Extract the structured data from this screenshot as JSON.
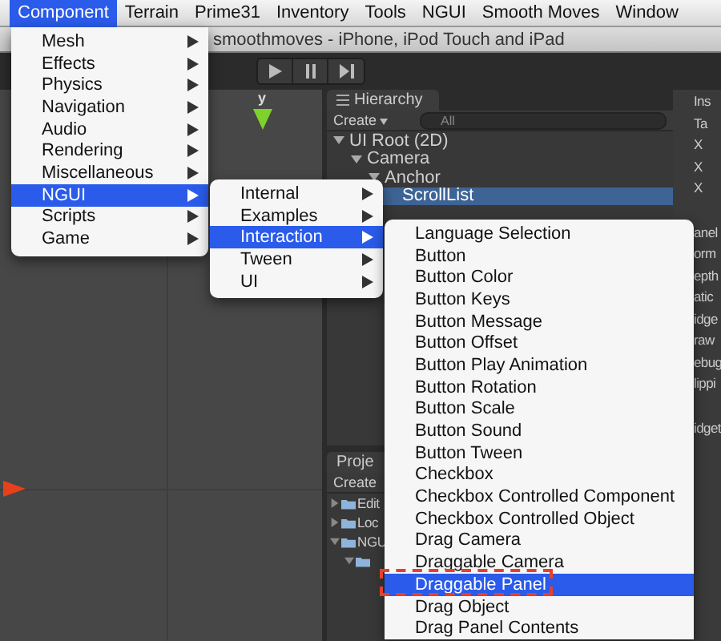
{
  "menu_bar": {
    "items": [
      {
        "label": "Component",
        "selected": true
      },
      {
        "label": "Terrain",
        "selected": false
      },
      {
        "label": "Prime31",
        "selected": false
      },
      {
        "label": "Inventory",
        "selected": false
      },
      {
        "label": "Tools",
        "selected": false
      },
      {
        "label": "NGUI",
        "selected": false
      },
      {
        "label": "Smooth Moves",
        "selected": false
      },
      {
        "label": "Window",
        "selected": false
      }
    ]
  },
  "window": {
    "title": "smoothmoves - iPhone, iPod Touch and iPad"
  },
  "scene": {
    "axis_label": "y"
  },
  "hierarchy": {
    "tab": "Hierarchy",
    "create": "Create",
    "search_placeholder": "All",
    "tree": [
      {
        "label": "UI Root (2D)",
        "expanded": true,
        "selected": false,
        "children": [
          {
            "label": "Camera",
            "expanded": true,
            "selected": false,
            "children": [
              {
                "label": "Anchor",
                "expanded": true,
                "selected": false,
                "children": [
                  {
                    "label": "ScrollList",
                    "selected": true
                  }
                ]
              }
            ]
          }
        ]
      }
    ]
  },
  "inspector": {
    "tab": "Ins",
    "texts": [
      "Ta",
      "X",
      "X",
      "X",
      "anel",
      "orm",
      "epth",
      "atic",
      "idge",
      "raw",
      "ebug",
      "lippi",
      "idget"
    ]
  },
  "project": {
    "tab": "Proje",
    "create": "Create",
    "tree": [
      {
        "label": "Edit",
        "expanded": false
      },
      {
        "label": "Loc",
        "expanded": false
      },
      {
        "label": "NGU",
        "expanded": true,
        "children": [
          {
            "expanded": true
          }
        ]
      }
    ]
  },
  "component_menu": {
    "items": [
      {
        "label": "Mesh",
        "selected": false,
        "has_submenu": true
      },
      {
        "label": "Effects",
        "selected": false,
        "has_submenu": true
      },
      {
        "label": "Physics",
        "selected": false,
        "has_submenu": true
      },
      {
        "label": "Navigation",
        "selected": false,
        "has_submenu": true
      },
      {
        "label": "Audio",
        "selected": false,
        "has_submenu": true
      },
      {
        "label": "Rendering",
        "selected": false,
        "has_submenu": true
      },
      {
        "label": "Miscellaneous",
        "selected": false,
        "has_submenu": true
      },
      {
        "label": "NGUI",
        "selected": true,
        "has_submenu": true
      },
      {
        "label": "Scripts",
        "selected": false,
        "has_submenu": true
      },
      {
        "label": "Game",
        "selected": false,
        "has_submenu": true
      }
    ]
  },
  "ngui_menu": {
    "items": [
      {
        "label": "Internal",
        "selected": false,
        "has_submenu": true
      },
      {
        "label": "Examples",
        "selected": false,
        "has_submenu": true
      },
      {
        "label": "Interaction",
        "selected": true,
        "has_submenu": true
      },
      {
        "label": "Tween",
        "selected": false,
        "has_submenu": true
      },
      {
        "label": "UI",
        "selected": false,
        "has_submenu": true
      }
    ]
  },
  "interaction_menu": {
    "items": [
      {
        "label": "Language Selection",
        "selected": false
      },
      {
        "label": "Button",
        "selected": false
      },
      {
        "label": "Button Color",
        "selected": false
      },
      {
        "label": "Button Keys",
        "selected": false
      },
      {
        "label": "Button Message",
        "selected": false
      },
      {
        "label": "Button Offset",
        "selected": false
      },
      {
        "label": "Button Play Animation",
        "selected": false
      },
      {
        "label": "Button Rotation",
        "selected": false
      },
      {
        "label": "Button Scale",
        "selected": false
      },
      {
        "label": "Button Sound",
        "selected": false
      },
      {
        "label": "Button Tween",
        "selected": false
      },
      {
        "label": "Checkbox",
        "selected": false
      },
      {
        "label": "Checkbox Controlled Component",
        "selected": false
      },
      {
        "label": "Checkbox Controlled Object",
        "selected": false
      },
      {
        "label": "Drag Camera",
        "selected": false
      },
      {
        "label": "Draggable Camera",
        "selected": false
      },
      {
        "label": "Draggable Panel",
        "selected": true
      },
      {
        "label": "Drag Object",
        "selected": false
      },
      {
        "label": "Drag Panel Contents",
        "selected": false
      }
    ]
  }
}
